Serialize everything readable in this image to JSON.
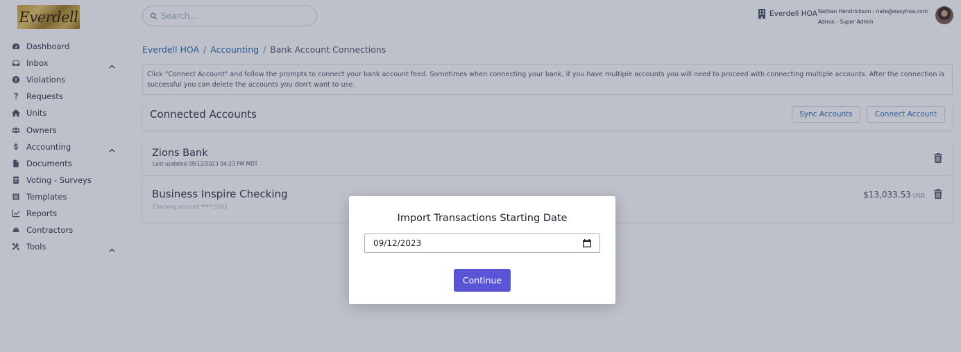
{
  "logo": {
    "text": "Everdell"
  },
  "sidebar": {
    "items": [
      {
        "label": "Dashboard",
        "icon": "dashboard-icon",
        "chevron": false
      },
      {
        "label": "Inbox",
        "icon": "inbox-icon",
        "chevron": true
      },
      {
        "label": "Violations",
        "icon": "alert-circle-icon",
        "chevron": false
      },
      {
        "label": "Requests",
        "icon": "question-mark-icon",
        "chevron": false
      },
      {
        "label": "Units",
        "icon": "home-icon",
        "chevron": false
      },
      {
        "label": "Owners",
        "icon": "users-icon",
        "chevron": false
      },
      {
        "label": "Accounting",
        "icon": "dollar-icon",
        "chevron": true
      },
      {
        "label": "Documents",
        "icon": "document-icon",
        "chevron": false
      },
      {
        "label": "Voting - Surveys",
        "icon": "ballot-icon",
        "chevron": false
      },
      {
        "label": "Templates",
        "icon": "list-icon",
        "chevron": false
      },
      {
        "label": "Reports",
        "icon": "chart-line-icon",
        "chevron": false
      },
      {
        "label": "Contractors",
        "icon": "hard-hat-icon",
        "chevron": false
      },
      {
        "label": "Tools",
        "icon": "tools-icon",
        "chevron": true
      }
    ]
  },
  "search": {
    "placeholder": "Search..."
  },
  "header": {
    "org_name": "Everdell HOA",
    "user_line": "Nathan Hendrickson - nate@easyhoa.com",
    "role_line": "Admin - Super Admin"
  },
  "breadcrumb": {
    "items": [
      "Everdell HOA",
      "Accounting"
    ],
    "separator": "/",
    "current": "Bank Account Connections"
  },
  "info_text": "Click \"Connect Account\" and follow the prompts to connect your bank account feed. Sometimes when connecting your bank, if you have multiple accounts you will need to proceed with connecting multiple accounts. After the connection is successful you can delete the accounts you don't want to use.",
  "connected": {
    "title": "Connected Accounts",
    "sync_label": "Sync Accounts",
    "connect_label": "Connect Account"
  },
  "bank": {
    "name": "Zions Bank",
    "updated": "Last updated 09/12/2023 04:23 PM MDT",
    "account": {
      "name": "Business Inspire Checking",
      "number": "Checking account *****3183",
      "balance": "$13,033.53",
      "currency": "USD"
    }
  },
  "modal": {
    "title": "Import Transactions Starting Date",
    "date_value": "09/12/2023",
    "continue_label": "Continue"
  },
  "colors": {
    "primary": "#5a54d6",
    "link": "#2b6cb0"
  }
}
